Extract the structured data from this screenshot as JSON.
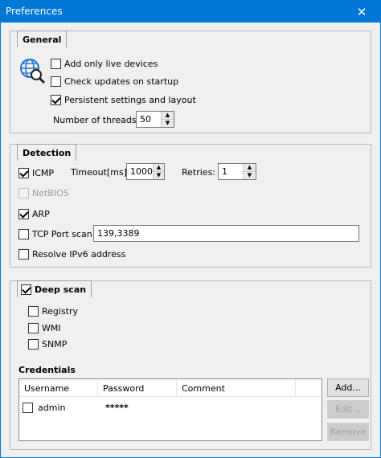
{
  "window": {
    "title": "Preferences",
    "close_glyph": "✕"
  },
  "general": {
    "title": "General",
    "icon": "globe-search-icon",
    "add_only_live": {
      "label": "Add only live devices",
      "checked": false
    },
    "check_updates": {
      "label": "Check updates on startup",
      "checked": false
    },
    "persistent": {
      "label": "Persistent settings and layout",
      "checked": true
    },
    "threads_label": "Number of threads:",
    "threads_value": "50"
  },
  "detection": {
    "title": "Detection",
    "icmp": {
      "label": "ICMP",
      "checked": true
    },
    "timeout_label": "Timeout[ms]:",
    "timeout_value": "1000",
    "retries_label": "Retries:",
    "retries_value": "1",
    "netbios": {
      "label": "NetBIOS",
      "checked": false,
      "disabled": true
    },
    "arp": {
      "label": "ARP",
      "checked": true
    },
    "tcp": {
      "label": "TCP Port scan",
      "checked": false
    },
    "tcp_ports": "139,3389",
    "ipv6": {
      "label": "Resolve IPv6 address",
      "checked": false
    }
  },
  "deepscan": {
    "title": "Deep scan",
    "checked": true,
    "registry": {
      "label": "Registry",
      "checked": false
    },
    "wmi": {
      "label": "WMI",
      "checked": false
    },
    "snmp": {
      "label": "SNMP",
      "checked": false
    },
    "credentials_label": "Credentials",
    "columns": [
      "Username",
      "Password",
      "Comment"
    ],
    "rows": [
      {
        "username": "admin",
        "password": "*****",
        "comment": ""
      }
    ],
    "buttons": {
      "add": "Add...",
      "edit": "Edit...",
      "remove": "Remove"
    }
  }
}
